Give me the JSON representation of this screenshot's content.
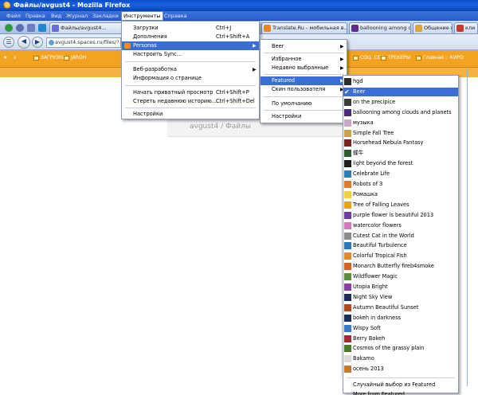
{
  "window": {
    "title": "Файлы/avgust4 - Mozilla Firefox"
  },
  "menubar": {
    "items": [
      "Файл",
      "Правка",
      "Вид",
      "Журнал",
      "Закладки",
      "Инструменты",
      "Справка"
    ],
    "active": "Инструменты"
  },
  "tabs": [
    {
      "label": "",
      "color": "#2f9a3d"
    },
    {
      "label": "",
      "color": "#5b6fb0"
    },
    {
      "label": "",
      "color": "#6b7fbf"
    },
    {
      "label": "",
      "color": "#1f8acb"
    },
    {
      "label": "Файлы/avgust4...",
      "color": "#6a6dd6"
    },
    {
      "label": "Translate.Ru - мобильная в...",
      "color": "#e88722"
    },
    {
      "label": "ballooning among clouds and ...",
      "color": "#5c2c8f"
    },
    {
      "label": "Общение и коммуникация ...",
      "color": "#d8a63a"
    },
    {
      "label": "кли",
      "color": "#c43b2d"
    }
  ],
  "navbar": {
    "url": "avgust4.spaces.ru/files/?..."
  },
  "bookmarks": [
    "ЗАГРУЗКИ",
    "JAROH",
    "СОЦ. СЕТИ",
    "ТРЕКЕРЫ",
    "Главная :: КИРО"
  ],
  "page": {
    "heading": "avgust4 / Файлы"
  },
  "tools_menu": {
    "items": [
      {
        "label": "Загрузки",
        "shortcut": "Ctrl+J"
      },
      {
        "label": "Дополнения",
        "shortcut": "Ctrl+Shift+A"
      },
      {
        "label": "Personas",
        "shortcut": "",
        "submenu": true,
        "highlighted": true
      },
      {
        "label": "Настроить Sync...",
        "shortcut": ""
      },
      {
        "label": "Веб-разработка",
        "shortcut": "",
        "submenu": true
      },
      {
        "label": "Информация о странице",
        "shortcut": ""
      },
      {
        "label": "Начать приватный просмотр",
        "shortcut": "Ctrl+Shift+P"
      },
      {
        "label": "Стереть недавнюю историю...",
        "shortcut": "Ctrl+Shift+Del"
      },
      {
        "label": "Настройки",
        "shortcut": ""
      }
    ]
  },
  "personas_menu": {
    "items": [
      {
        "label": "Beer",
        "submenu": true
      },
      {
        "label": "Избранное",
        "submenu": true
      },
      {
        "label": "Недавно выбранные",
        "submenu": true
      },
      {
        "label": "Featured",
        "submenu": true,
        "highlighted": true
      },
      {
        "label": "Скин пользователя",
        "submenu": true
      },
      {
        "label": "По умолчанию"
      },
      {
        "label": "Настройки"
      }
    ]
  },
  "featured_menu": {
    "items": [
      {
        "label": "hgd",
        "thumb": "#2d2d2d"
      },
      {
        "label": "Beer",
        "thumb": "#3a6ed4",
        "checked": true,
        "highlighted": true
      },
      {
        "label": "on the precipice",
        "thumb": "#3b3b3b"
      },
      {
        "label": "ballooning among clouds and planets",
        "thumb": "#4a2a7a"
      },
      {
        "label": "музыка",
        "thumb": "#c9a9c7"
      },
      {
        "label": "Simple Fall Tree",
        "thumb": "#c9a24a"
      },
      {
        "label": "Horsehead Nebula Fantasy",
        "thumb": "#7b1f1f"
      },
      {
        "label": "蝶牛",
        "thumb": "#2e5b2e"
      },
      {
        "label": "light beyond the forest",
        "thumb": "#1d1d1d"
      },
      {
        "label": "Celebrate Life",
        "thumb": "#2b7fb8"
      },
      {
        "label": "Robots of 3",
        "thumb": "#e07b2c"
      },
      {
        "label": "Ромашка",
        "thumb": "#f2d14a"
      },
      {
        "label": "Tree of Falling Leaves",
        "thumb": "#e6a21c"
      },
      {
        "label": "purple flower is beautiful 2013",
        "thumb": "#6b3fa0"
      },
      {
        "label": "watercolor flowers",
        "thumb": "#d47ab8"
      },
      {
        "label": "Cutest Cat in the World",
        "thumb": "#8c8c8c"
      },
      {
        "label": "Beautiful Turbulence",
        "thumb": "#2a7ab8"
      },
      {
        "label": "Colorful Tropical Fish",
        "thumb": "#e08a2a"
      },
      {
        "label": "Monarch Butterfly fireb4smoke",
        "thumb": "#d8611f"
      },
      {
        "label": "Wildflower Magic",
        "thumb": "#5a8f3a"
      },
      {
        "label": "Utopia Bright",
        "thumb": "#8a3fa3"
      },
      {
        "label": "Night Sky View",
        "thumb": "#1c2a5c"
      },
      {
        "label": "Autumn Beautiful Sunset",
        "thumb": "#b34a1a"
      },
      {
        "label": "bokeh in darkness",
        "thumb": "#1a2f5a"
      },
      {
        "label": "Wispy Soft",
        "thumb": "#3a7ac9"
      },
      {
        "label": "Berry Bokeh",
        "thumb": "#a3283c"
      },
      {
        "label": "Cosmos of the grassy plain",
        "thumb": "#4a7a2a"
      },
      {
        "label": "Bakamo",
        "thumb": "#dcdcdc"
      },
      {
        "label": "осень 2013",
        "thumb": "#c8782a"
      }
    ],
    "footer": [
      {
        "label": "Случайный выбор из Featured"
      },
      {
        "label": "More from Featured..."
      }
    ]
  }
}
